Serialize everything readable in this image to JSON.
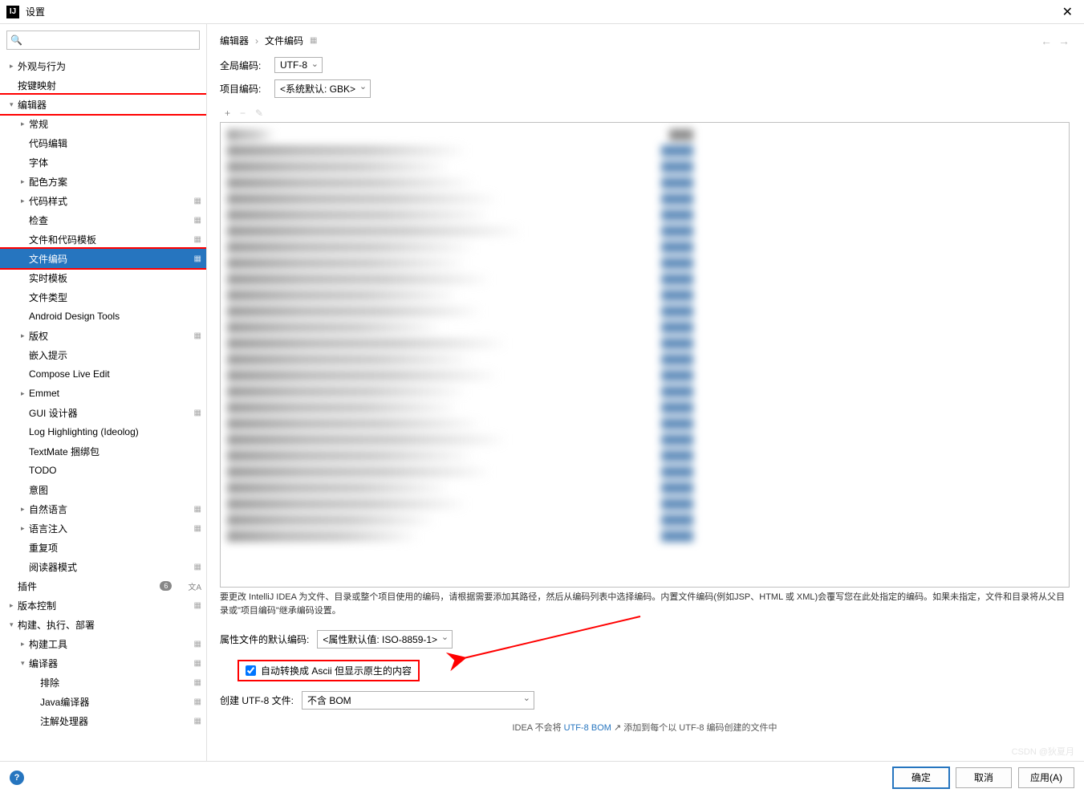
{
  "window": {
    "title": "设置"
  },
  "search": {
    "placeholder": ""
  },
  "sidebar": {
    "items": [
      {
        "label": "外观与行为",
        "level": 0,
        "expandable": true,
        "expanded": false
      },
      {
        "label": "按键映射",
        "level": 0,
        "expandable": false
      },
      {
        "label": "编辑器",
        "level": 0,
        "expandable": true,
        "expanded": true,
        "highlight": "red"
      },
      {
        "label": "常规",
        "level": 1,
        "expandable": true,
        "expanded": false
      },
      {
        "label": "代码编辑",
        "level": 1,
        "expandable": false
      },
      {
        "label": "字体",
        "level": 1,
        "expandable": false
      },
      {
        "label": "配色方案",
        "level": 1,
        "expandable": true,
        "expanded": false
      },
      {
        "label": "代码样式",
        "level": 1,
        "expandable": true,
        "expanded": false,
        "gear": true
      },
      {
        "label": "检查",
        "level": 1,
        "expandable": false,
        "gear": true
      },
      {
        "label": "文件和代码模板",
        "level": 1,
        "expandable": false,
        "gear": true
      },
      {
        "label": "文件编码",
        "level": 1,
        "expandable": false,
        "gear": true,
        "selected": true,
        "highlight": "red"
      },
      {
        "label": "实时模板",
        "level": 1,
        "expandable": false
      },
      {
        "label": "文件类型",
        "level": 1,
        "expandable": false
      },
      {
        "label": "Android Design Tools",
        "level": 1,
        "expandable": false
      },
      {
        "label": "版权",
        "level": 1,
        "expandable": true,
        "expanded": false,
        "gear": true
      },
      {
        "label": "嵌入提示",
        "level": 1,
        "expandable": false
      },
      {
        "label": "Compose Live Edit",
        "level": 1,
        "expandable": false
      },
      {
        "label": "Emmet",
        "level": 1,
        "expandable": true,
        "expanded": false
      },
      {
        "label": "GUI 设计器",
        "level": 1,
        "expandable": false,
        "gear": true
      },
      {
        "label": "Log Highlighting (Ideolog)",
        "level": 1,
        "expandable": false
      },
      {
        "label": "TextMate 捆绑包",
        "level": 1,
        "expandable": false
      },
      {
        "label": "TODO",
        "level": 1,
        "expandable": false
      },
      {
        "label": "意图",
        "level": 1,
        "expandable": false
      },
      {
        "label": "自然语言",
        "level": 1,
        "expandable": true,
        "expanded": false,
        "gear": true
      },
      {
        "label": "语言注入",
        "level": 1,
        "expandable": true,
        "expanded": false,
        "gear": true
      },
      {
        "label": "重复项",
        "level": 1,
        "expandable": false
      },
      {
        "label": "阅读器模式",
        "level": 1,
        "expandable": false,
        "gear": true
      },
      {
        "label": "插件",
        "level": 0,
        "expandable": false,
        "badge": "6",
        "lang_icon": true
      },
      {
        "label": "版本控制",
        "level": 0,
        "expandable": true,
        "expanded": false,
        "gear": true
      },
      {
        "label": "构建、执行、部署",
        "level": 0,
        "expandable": true,
        "expanded": true
      },
      {
        "label": "构建工具",
        "level": 1,
        "expandable": true,
        "expanded": false,
        "gear": true
      },
      {
        "label": "编译器",
        "level": 1,
        "expandable": true,
        "expanded": true,
        "gear": true
      },
      {
        "label": "排除",
        "level": 2,
        "expandable": false,
        "gear": true
      },
      {
        "label": "Java编译器",
        "level": 2,
        "expandable": false,
        "gear": true
      },
      {
        "label": "注解处理器",
        "level": 2,
        "expandable": false,
        "gear": true
      }
    ]
  },
  "breadcrumb": {
    "part1": "编辑器",
    "part2": "文件编码"
  },
  "fields": {
    "global_encoding_label": "全局编码:",
    "global_encoding_value": "UTF-8",
    "project_encoding_label": "项目编码:",
    "project_encoding_value": "<系统默认: GBK>",
    "props_encoding_label": "属性文件的默认编码:",
    "props_encoding_value": "<属性默认值: ISO-8859-1>",
    "ascii_checkbox_label": "自动转换成 Ascii 但显示原生的内容",
    "ascii_checked": true,
    "bom_label": "创建 UTF-8 文件:",
    "bom_value": "不含 BOM"
  },
  "description": "要更改 IntelliJ IDEA 为文件、目录或整个项目使用的编码，请根据需要添加其路径，然后从编码列表中选择编码。内置文件编码(例如JSP、HTML 或 XML)会覆写您在此处指定的编码。如果未指定，文件和目录将从父目录或\"项目编码\"继承编码设置。",
  "hint": {
    "prefix": "IDEA 不会将 ",
    "link": "UTF-8 BOM",
    "suffix": " ↗ 添加到每个以 UTF-8 编码创建的文件中"
  },
  "buttons": {
    "ok": "确定",
    "cancel": "取消",
    "apply": "应用(A)"
  },
  "watermark": "CSDN @狄夏月"
}
